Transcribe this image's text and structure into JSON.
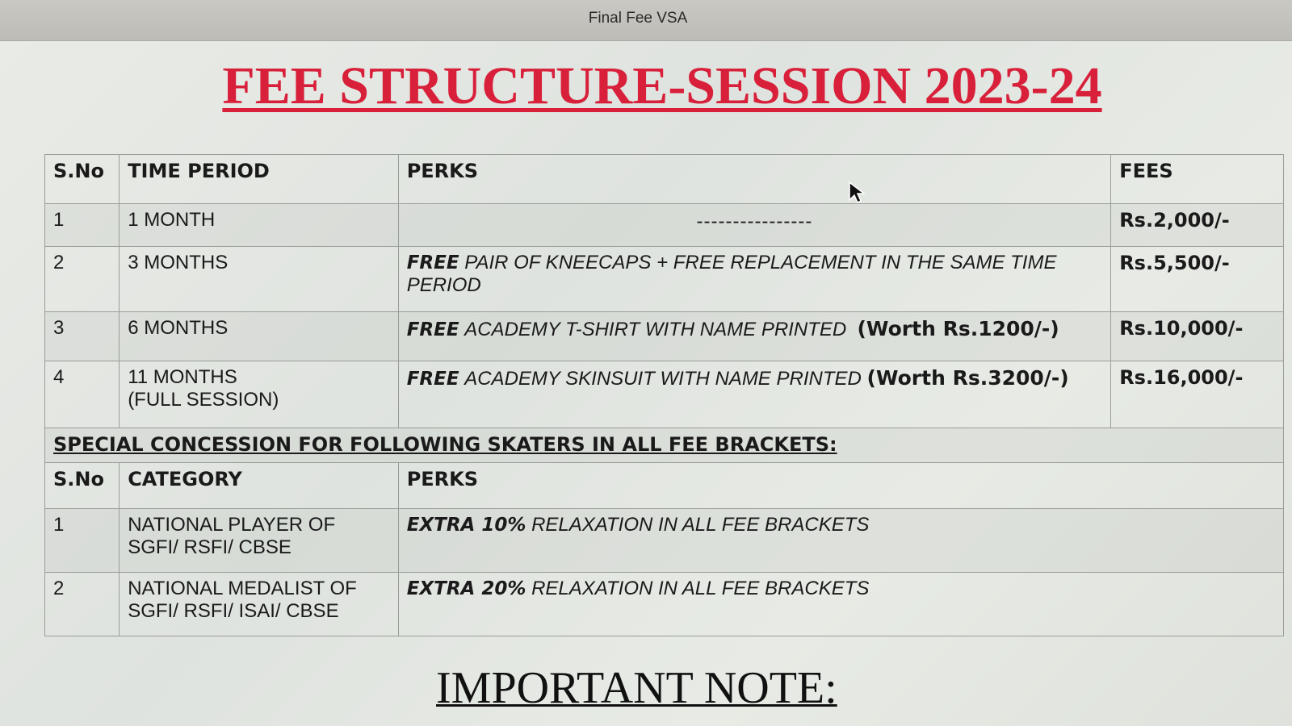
{
  "window": {
    "title": "Final Fee VSA"
  },
  "document": {
    "title": "FEE STRUCTURE-SESSION 2023-24",
    "fee_table": {
      "headers": {
        "sno": "S.No",
        "time_period": "TIME PERIOD",
        "perks": "PERKS",
        "fees": "FEES"
      },
      "rows": [
        {
          "sno": "1",
          "time_period": "1 MONTH",
          "perk_free": "",
          "perk_text": "----------------",
          "perk_worth": "",
          "fees": "Rs.2,000/-"
        },
        {
          "sno": "2",
          "time_period": "3 MONTHS",
          "perk_free": "FREE",
          "perk_text": "PAIR OF KNEECAPS + FREE REPLACEMENT IN THE SAME TIME PERIOD",
          "perk_worth": "",
          "fees": "Rs.5,500/-"
        },
        {
          "sno": "3",
          "time_period": "6 MONTHS",
          "perk_free": "FREE",
          "perk_text": "ACADEMY T-SHIRT WITH NAME PRINTED",
          "perk_worth": "(Worth Rs.1200/-)",
          "fees": "Rs.10,000/-"
        },
        {
          "sno": "4",
          "time_period": "11 MONTHS",
          "time_period_sub": "(FULL SESSION)",
          "perk_free": "FREE",
          "perk_text": "ACADEMY SKINSUIT WITH NAME PRINTED",
          "perk_worth": "(Worth Rs.3200/-)",
          "fees": "Rs.16,000/-"
        }
      ]
    },
    "concession": {
      "heading": "SPECIAL CONCESSION FOR FOLLOWING SKATERS IN ALL FEE BRACKETS:",
      "headers": {
        "sno": "S.No",
        "category": "CATEGORY",
        "perks": "PERKS"
      },
      "rows": [
        {
          "sno": "1",
          "category": "NATIONAL PLAYER OF SGFI/ RSFI/ CBSE",
          "perk_bold": "EXTRA 10%",
          "perk_text": "RELAXATION IN ALL FEE BRACKETS"
        },
        {
          "sno": "2",
          "category": "NATIONAL MEDALIST OF SGFI/ RSFI/ ISAI/ CBSE",
          "perk_bold": "EXTRA 20%",
          "perk_text": "RELAXATION IN ALL FEE BRACKETS"
        }
      ]
    },
    "note_heading": "IMPORTANT NOTE:"
  },
  "colors": {
    "title_red": "#d8203a",
    "text": "#1a1a1a"
  }
}
